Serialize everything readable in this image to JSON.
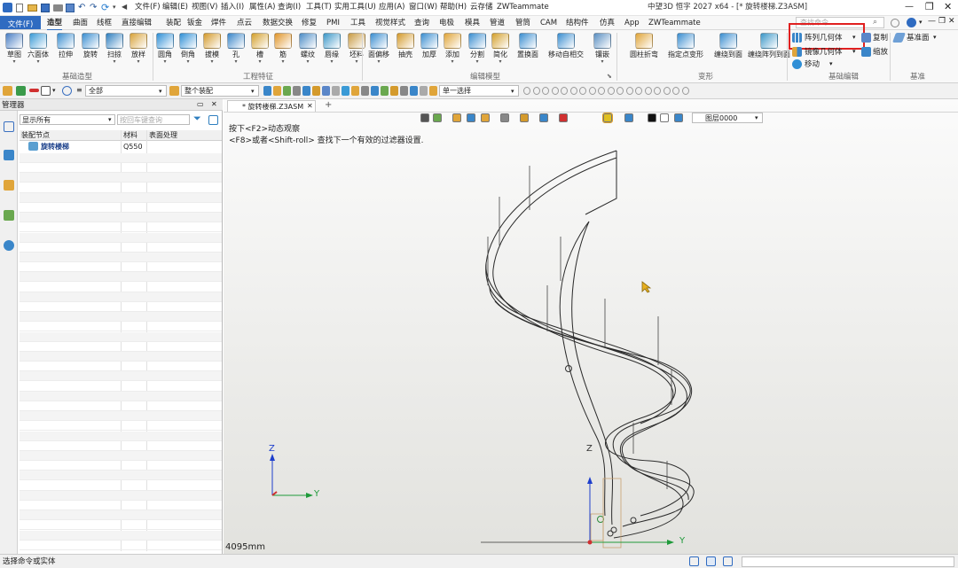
{
  "window": {
    "title": "中望3D 恒字 2027 x64 - [* 旋转楼梯.Z3ASM]"
  },
  "quick_menu": [
    "文件(F)",
    "编辑(E)",
    "视图(V)",
    "插入(I)",
    "属性(A)",
    "查询(I)",
    "工具(T)",
    "实用工具(U)",
    "应用(A)",
    "窗口(W)",
    "帮助(H)",
    "云存储",
    "ZWTeammate"
  ],
  "tabs": {
    "file": "文件(F)",
    "items": [
      "造型",
      "曲面",
      "线框",
      "直接编辑",
      "装配",
      "钣金",
      "焊件",
      "点云",
      "数据交换",
      "修复",
      "PMI",
      "工具",
      "视觉样式",
      "查询",
      "电极",
      "模具",
      "管道",
      "管筒",
      "CAM",
      "结构件",
      "仿真",
      "App",
      "ZWTeammate"
    ],
    "active": "造型"
  },
  "search": {
    "placeholder": "查找命令"
  },
  "ribbon": {
    "tools": [
      {
        "label": "草图",
        "color": "#4a7fc4",
        "dd": true
      },
      {
        "label": "六面体",
        "color": "#3a9ad6",
        "dd": true
      },
      {
        "label": "拉伸",
        "color": "#3b8ed0",
        "dd": false
      },
      {
        "label": "旋转",
        "color": "#3b8ed0",
        "dd": false
      },
      {
        "label": "扫掠",
        "color": "#2f7fbf",
        "dd": true
      },
      {
        "label": "放样",
        "color": "#d8a23a",
        "dd": true
      },
      {
        "label": "圆角",
        "color": "#2f8fd6",
        "dd": true
      },
      {
        "label": "倒角",
        "color": "#2f8fd6",
        "dd": true
      },
      {
        "label": "拔模",
        "color": "#d49a2c",
        "dd": true
      },
      {
        "label": "孔",
        "color": "#3a86c9",
        "dd": true
      },
      {
        "label": "槽",
        "color": "#d4a02c",
        "dd": true
      },
      {
        "label": "筋",
        "color": "#e0952a",
        "dd": true
      },
      {
        "label": "螺纹",
        "color": "#4c8cc6",
        "dd": true
      },
      {
        "label": "唇缘",
        "color": "#3c97c8",
        "dd": true
      },
      {
        "label": "坯料",
        "color": "#c99b44",
        "dd": true
      },
      {
        "label": "面偏移",
        "color": "#3b8ed0",
        "dd": true
      },
      {
        "label": "抽壳",
        "color": "#d49a2c",
        "dd": false
      },
      {
        "label": "加厚",
        "color": "#3b8ed0",
        "dd": false
      },
      {
        "label": "添加",
        "color": "#e0a53a",
        "dd": true
      },
      {
        "label": "分割",
        "color": "#3b8ed0",
        "dd": true
      },
      {
        "label": "简化",
        "color": "#d4a02c",
        "dd": true
      },
      {
        "label": "置换面",
        "color": "#3b8ed0",
        "dd": false
      },
      {
        "label": "移动自相交",
        "color": "#3b8ed0",
        "dd": false
      },
      {
        "label": "镶嵌",
        "color": "#5a8fc2",
        "dd": true
      },
      {
        "label": "圆柱折弯",
        "color": "#e0a53a",
        "dd": false
      },
      {
        "label": "指定点变形",
        "color": "#3b8ed0",
        "dd": false
      },
      {
        "label": "缠绕到面",
        "color": "#3b8ed0",
        "dd": false
      },
      {
        "label": "缠绕阵列到面",
        "color": "#3c97c8",
        "dd": false
      }
    ],
    "groups": [
      "基础造型",
      "工程特征",
      "编辑模型",
      "变形",
      "基础编辑",
      "基准"
    ],
    "small": {
      "array": "阵列几何体",
      "copy": "复制",
      "mirror": "镜像几何体",
      "scale": "缩放",
      "move": "移动",
      "datum": "基准面"
    }
  },
  "cmdbar": {
    "filter_value": "全部",
    "assembly_value": "整个装配",
    "select_mode": "单一选择"
  },
  "manager": {
    "title": "管理器",
    "display_filter": "显示所有",
    "search_placeholder": "按回车键查询",
    "columns": [
      "装配节点",
      "材料",
      "表面处理"
    ],
    "rows": [
      {
        "node": "旋转楼梯",
        "material": "Q550",
        "surface": ""
      }
    ]
  },
  "viewport": {
    "tab": "* 旋转楼梯.Z3ASM",
    "hint1": "按下<F2>动态观察",
    "hint2": "<F8>或者<Shift-roll> 查找下一个有效的过滤器设置.",
    "layer": "图层0000",
    "scale": "4095mm",
    "axes": {
      "z": "Z",
      "y": "Y"
    }
  },
  "status": {
    "text": "选择命令或实体"
  },
  "colors": {
    "highlight_box": "#e02020",
    "tab_file_bg": "#2f6bc1",
    "axis_y": "#1f9a3a",
    "axis_z": "#1e3fcc",
    "axis_x": "#d03030"
  }
}
